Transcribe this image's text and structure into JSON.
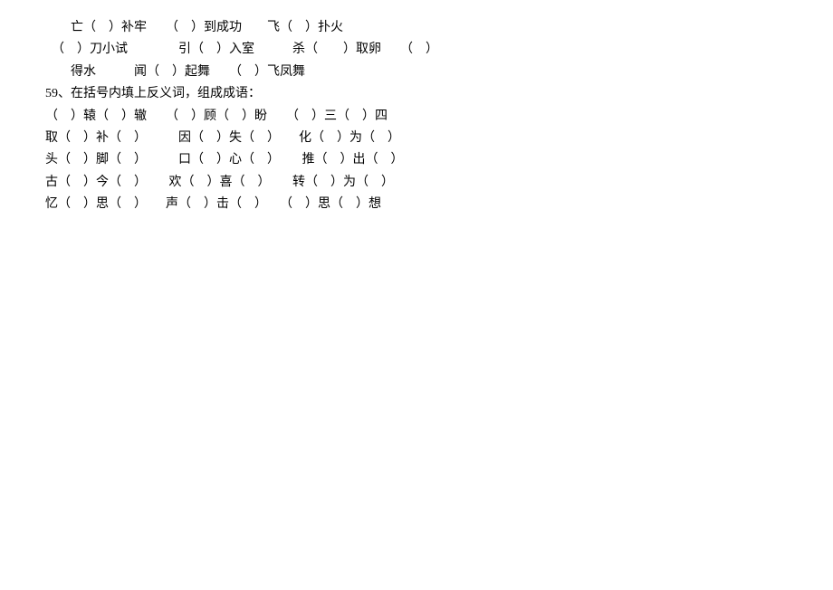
{
  "lines": [
    "　　亡（　）补牢　　（　）到成功　　飞（　）扑火　　",
    "　（　）刀小试　　　　引（　）入室　　　杀（　　）取卵　　（　）",
    "　　得水　　　闻（　）起舞　　（　）飞凤舞",
    "59、在括号内填上反义词，组成成语：",
    "（　）辕（　）辙　　（　）顾（　）盼　　（　）三（　）四",
    "取（　）补（　）　　　因（　）失（　）　　化（　）为（　）",
    "头（　）脚（　）　　　口（　）心（　）　　 推（　）出（　）",
    "古（　）今（　）　 　欢（　）喜（　）　 　转（　）为（　）",
    "忆（　）思（　）　　声（　）击（　）　　（　）思（　）想"
  ]
}
